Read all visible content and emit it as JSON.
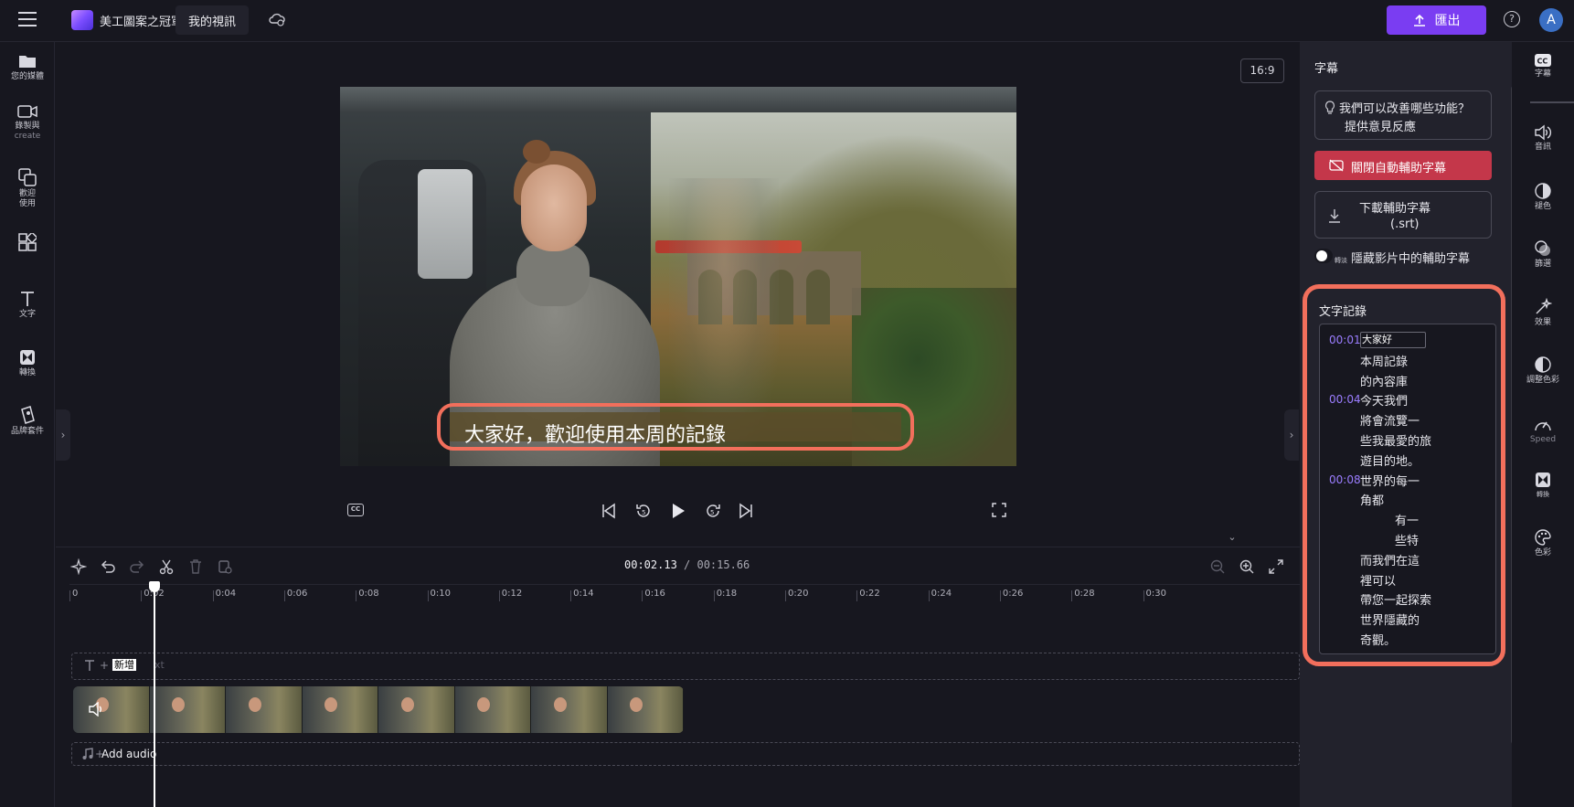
{
  "header": {
    "app_name": "美工圖案之冠軍",
    "project_name": "我的視訊",
    "export_label": "匯出",
    "avatar_initial": "A",
    "help_symbol": "?",
    "accent_color": "#7a3df2"
  },
  "left_nav": [
    {
      "label": "您的媒體",
      "sub": ""
    },
    {
      "label": "錄製與",
      "sub": "create"
    },
    {
      "label": "歡迎\n使用",
      "sub": ""
    },
    {
      "label": "",
      "sub": ""
    },
    {
      "label": "文字",
      "sub": ""
    },
    {
      "label": "轉換",
      "sub": ""
    },
    {
      "label": "品牌套件",
      "sub": ""
    }
  ],
  "preview": {
    "aspect_ratio": "16:9",
    "subtitle": "大家好，歡迎使用本周的記錄",
    "cc_label": "CC"
  },
  "timeline": {
    "current_time": "00:02.13",
    "total_time": "/ 00:15.66",
    "ticks": [
      "0",
      "0:02",
      "0:04",
      "0:06",
      "0:08",
      "0:10",
      "0:12",
      "0:14",
      "0:16",
      "0:18",
      "0:20",
      "0:22",
      "0:24",
      "0:26",
      "0:28",
      "0:30"
    ],
    "text_track_label": "新增",
    "text_track_hint": "xt",
    "audio_track_label": "Add audio",
    "thumbnail_count": 8
  },
  "captions_panel": {
    "title": "字幕",
    "feedback_line1": "我們可以改善哪些功能？",
    "feedback_line2": "提供意見反應",
    "disable_label": "關閉自動輔助字幕",
    "download_line1": "下載輔助字幕",
    "download_line2": "(.srt)",
    "toggle_small": "轉淡",
    "toggle_label": "隱藏影片中的輔助字幕",
    "transcript_title": "文字記錄",
    "transcript": [
      {
        "time": "00:01",
        "lines": [
          "大家好",
          "本周記錄",
          "的內容庫"
        ]
      },
      {
        "time": "00:04",
        "lines": [
          "今天我們",
          "將會流覽一",
          "些我最愛的旅",
          "遊目的地。"
        ]
      },
      {
        "time": "00:08",
        "lines": [
          "世界的每一",
          "角都",
          "有一",
          "些特",
          "而我們在這",
          "裡可以",
          "帶您一起探索",
          "世界隱藏的",
          "奇觀。"
        ]
      }
    ]
  },
  "right_rail": [
    {
      "label": "字幕",
      "icon": "cc-icon"
    },
    {
      "label": "音訊",
      "icon": "speaker-icon"
    },
    {
      "label": "褪色",
      "icon": "fade-icon"
    },
    {
      "label": "篩選",
      "icon": "filter-icon"
    },
    {
      "label": "效果",
      "icon": "magic-wand-icon"
    },
    {
      "label": "調整色彩",
      "icon": "adjust-color-icon"
    },
    {
      "label": "Speed",
      "icon": "speed-icon"
    },
    {
      "label": "轉換",
      "icon": "transition-icon"
    },
    {
      "label": "色彩",
      "icon": "palette-icon"
    }
  ]
}
